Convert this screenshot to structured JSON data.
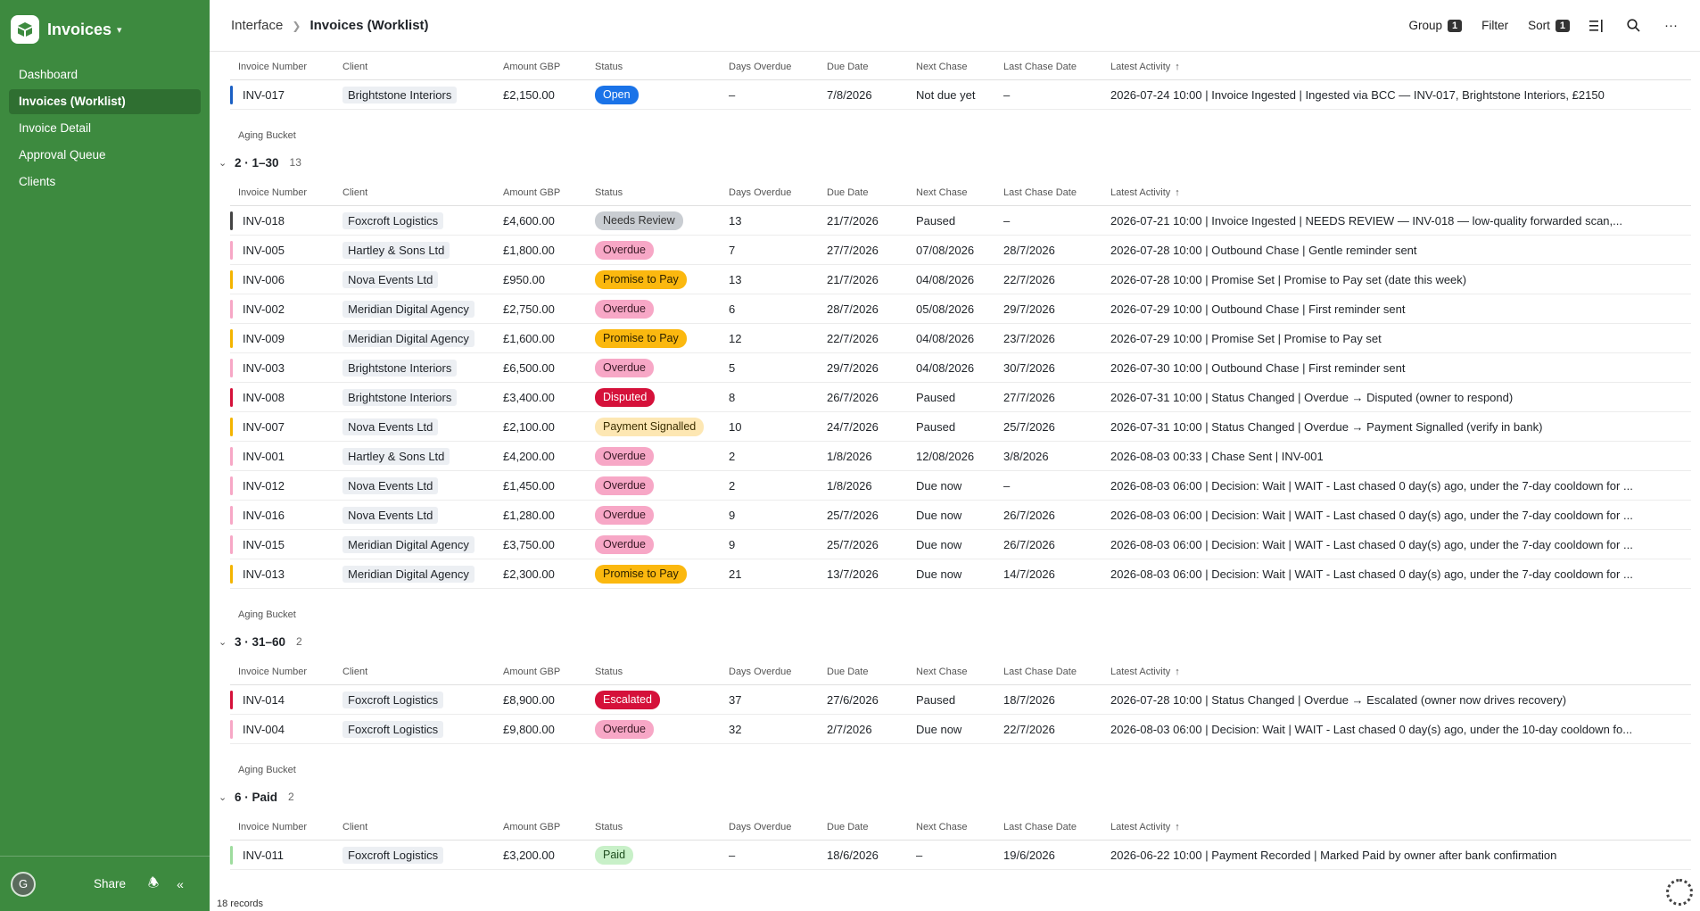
{
  "app": {
    "title": "Invoices"
  },
  "nav": [
    {
      "label": "Dashboard",
      "active": false
    },
    {
      "label": "Invoices (Worklist)",
      "active": true
    },
    {
      "label": "Invoice Detail",
      "active": false
    },
    {
      "label": "Approval Queue",
      "active": false
    },
    {
      "label": "Clients",
      "active": false
    }
  ],
  "footer": {
    "avatar": "G",
    "share": "Share"
  },
  "breadcrumb": {
    "parent": "Interface",
    "current": "Invoices (Worklist)"
  },
  "toolbar": {
    "group_label": "Group",
    "group_count": "1",
    "filter_label": "Filter",
    "sort_label": "Sort",
    "sort_count": "1"
  },
  "columns": {
    "invoice": "Invoice Number",
    "client": "Client",
    "amount": "Amount GBP",
    "status": "Status",
    "days": "Days Overdue",
    "due": "Due Date",
    "next": "Next Chase",
    "last": "Last Chase Date",
    "activity": "Latest Activity"
  },
  "status_colors": {
    "Open": {
      "bg": "#1a73e8",
      "fg": "#ffffff",
      "strip": "#1a5fc4"
    },
    "Needs Review": {
      "bg": "#c9cdd2",
      "fg": "#333333",
      "strip": "#444444"
    },
    "Overdue": {
      "bg": "#f7a7c6",
      "fg": "#3a1a26",
      "strip": "#f7a7c6"
    },
    "Promise to Pay": {
      "bg": "#fbb80f",
      "fg": "#2b2000",
      "strip": "#f4b400"
    },
    "Disputed": {
      "bg": "#d5113a",
      "fg": "#ffffff",
      "strip": "#d5113a"
    },
    "Payment Signalled": {
      "bg": "#fde7b3",
      "fg": "#3b2e00",
      "strip": "#f4b400"
    },
    "Escalated": {
      "bg": "#d5113a",
      "fg": "#ffffff",
      "strip": "#d5113a"
    },
    "Paid": {
      "bg": "#c8f0c8",
      "fg": "#1e4d1e",
      "strip": "#9edc9e"
    }
  },
  "groups": [
    {
      "bucket_label": "",
      "title": "",
      "count": "",
      "rows": [
        {
          "invoice": "INV-017",
          "client": "Brightstone Interiors",
          "amount": "£2,150.00",
          "status": "Open",
          "days": "–",
          "due": "7/8/2026",
          "next": "Not due yet",
          "last": "–",
          "activity": "2026-07-24 10:00 | Invoice Ingested | Ingested via BCC — INV-017, Brightstone Interiors, £2150"
        }
      ]
    },
    {
      "bucket_label": "Aging Bucket",
      "title": "2 · 1–30",
      "count": "13",
      "rows": [
        {
          "invoice": "INV-018",
          "client": "Foxcroft Logistics",
          "amount": "£4,600.00",
          "status": "Needs Review",
          "days": "13",
          "due": "21/7/2026",
          "next": "Paused",
          "last": "–",
          "activity": "2026-07-21 10:00 | Invoice Ingested | NEEDS REVIEW — INV-018 — low-quality forwarded scan,..."
        },
        {
          "invoice": "INV-005",
          "client": "Hartley & Sons Ltd",
          "amount": "£1,800.00",
          "status": "Overdue",
          "days": "7",
          "due": "27/7/2026",
          "next": "07/08/2026",
          "last": "28/7/2026",
          "activity": "2026-07-28 10:00 | Outbound Chase | Gentle reminder sent"
        },
        {
          "invoice": "INV-006",
          "client": "Nova Events Ltd",
          "amount": "£950.00",
          "status": "Promise to Pay",
          "days": "13",
          "due": "21/7/2026",
          "next": "04/08/2026",
          "last": "22/7/2026",
          "activity": "2026-07-28 10:00 | Promise Set | Promise to Pay set (date this week)"
        },
        {
          "invoice": "INV-002",
          "client": "Meridian Digital Agency",
          "amount": "£2,750.00",
          "status": "Overdue",
          "days": "6",
          "due": "28/7/2026",
          "next": "05/08/2026",
          "last": "29/7/2026",
          "activity": "2026-07-29 10:00 | Outbound Chase | First reminder sent"
        },
        {
          "invoice": "INV-009",
          "client": "Meridian Digital Agency",
          "amount": "£1,600.00",
          "status": "Promise to Pay",
          "days": "12",
          "due": "22/7/2026",
          "next": "04/08/2026",
          "last": "23/7/2026",
          "activity": "2026-07-29 10:00 | Promise Set | Promise to Pay set"
        },
        {
          "invoice": "INV-003",
          "client": "Brightstone Interiors",
          "amount": "£6,500.00",
          "status": "Overdue",
          "days": "5",
          "due": "29/7/2026",
          "next": "04/08/2026",
          "last": "30/7/2026",
          "activity": "2026-07-30 10:00 | Outbound Chase | First reminder sent"
        },
        {
          "invoice": "INV-008",
          "client": "Brightstone Interiors",
          "amount": "£3,400.00",
          "status": "Disputed",
          "days": "8",
          "due": "26/7/2026",
          "next": "Paused",
          "last": "27/7/2026",
          "activity": "2026-07-31 10:00 | Status Changed | Overdue → Disputed (owner to respond)"
        },
        {
          "invoice": "INV-007",
          "client": "Nova Events Ltd",
          "amount": "£2,100.00",
          "status": "Payment Signalled",
          "days": "10",
          "due": "24/7/2026",
          "next": "Paused",
          "last": "25/7/2026",
          "activity": "2026-07-31 10:00 | Status Changed | Overdue → Payment Signalled (verify in bank)"
        },
        {
          "invoice": "INV-001",
          "client": "Hartley & Sons Ltd",
          "amount": "£4,200.00",
          "status": "Overdue",
          "days": "2",
          "due": "1/8/2026",
          "next": "12/08/2026",
          "last": "3/8/2026",
          "activity": "2026-08-03 00:33 | Chase Sent | INV-001"
        },
        {
          "invoice": "INV-012",
          "client": "Nova Events Ltd",
          "amount": "£1,450.00",
          "status": "Overdue",
          "days": "2",
          "due": "1/8/2026",
          "next": "Due now",
          "last": "–",
          "activity": "2026-08-03 06:00 | Decision: Wait | WAIT - Last chased 0 day(s) ago, under the 7-day cooldown for ..."
        },
        {
          "invoice": "INV-016",
          "client": "Nova Events Ltd",
          "amount": "£1,280.00",
          "status": "Overdue",
          "days": "9",
          "due": "25/7/2026",
          "next": "Due now",
          "last": "26/7/2026",
          "activity": "2026-08-03 06:00 | Decision: Wait | WAIT - Last chased 0 day(s) ago, under the 7-day cooldown for ..."
        },
        {
          "invoice": "INV-015",
          "client": "Meridian Digital Agency",
          "amount": "£3,750.00",
          "status": "Overdue",
          "days": "9",
          "due": "25/7/2026",
          "next": "Due now",
          "last": "26/7/2026",
          "activity": "2026-08-03 06:00 | Decision: Wait | WAIT - Last chased 0 day(s) ago, under the 7-day cooldown for ..."
        },
        {
          "invoice": "INV-013",
          "client": "Meridian Digital Agency",
          "amount": "£2,300.00",
          "status": "Promise to Pay",
          "days": "21",
          "due": "13/7/2026",
          "next": "Due now",
          "last": "14/7/2026",
          "activity": "2026-08-03 06:00 | Decision: Wait | WAIT - Last chased 0 day(s) ago, under the 7-day cooldown for ..."
        }
      ]
    },
    {
      "bucket_label": "Aging Bucket",
      "title": "3 · 31–60",
      "count": "2",
      "rows": [
        {
          "invoice": "INV-014",
          "client": "Foxcroft Logistics",
          "amount": "£8,900.00",
          "status": "Escalated",
          "days": "37",
          "due": "27/6/2026",
          "next": "Paused",
          "last": "18/7/2026",
          "activity": "2026-07-28 10:00 | Status Changed | Overdue → Escalated (owner now drives recovery)"
        },
        {
          "invoice": "INV-004",
          "client": "Foxcroft Logistics",
          "amount": "£9,800.00",
          "status": "Overdue",
          "days": "32",
          "due": "2/7/2026",
          "next": "Due now",
          "last": "22/7/2026",
          "activity": "2026-08-03 06:00 | Decision: Wait | WAIT - Last chased 0 day(s) ago, under the 10-day cooldown fo..."
        }
      ]
    },
    {
      "bucket_label": "Aging Bucket",
      "title": "6 · Paid",
      "count": "2",
      "rows": [
        {
          "invoice": "INV-011",
          "client": "Foxcroft Logistics",
          "amount": "£3,200.00",
          "status": "Paid",
          "days": "–",
          "due": "18/6/2026",
          "next": "–",
          "last": "19/6/2026",
          "activity": "2026-06-22 10:00 | Payment Recorded | Marked Paid by owner after bank confirmation"
        }
      ]
    }
  ],
  "records_label": "18 records"
}
